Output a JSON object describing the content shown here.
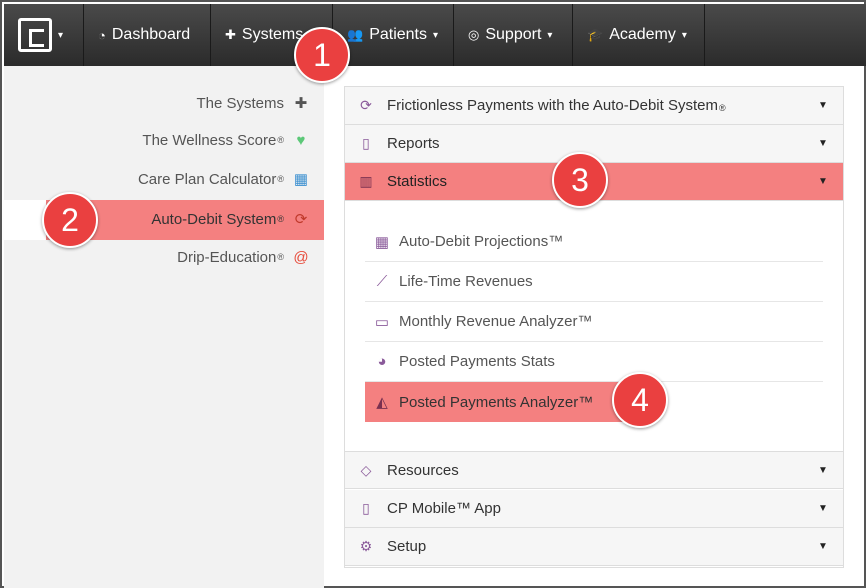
{
  "nav": {
    "brand_logo": "app-logo",
    "items": [
      {
        "label": "Dashboard",
        "icon": "dashboard-icon",
        "glyph": "◔"
      },
      {
        "label": "Systems",
        "icon": "puzzle-icon",
        "glyph": "✚"
      },
      {
        "label": "Patients",
        "icon": "users-icon",
        "glyph": "👥"
      },
      {
        "label": "Support",
        "icon": "lifebuoy-icon",
        "glyph": "◎"
      },
      {
        "label": "Academy",
        "icon": "graduation-cap-icon",
        "glyph": "🎓"
      }
    ],
    "caret": "▾"
  },
  "sidebar": {
    "items": [
      {
        "label": "The Systems",
        "sup": "",
        "icon": "puzzle-icon",
        "glyph": "✚",
        "color": "#555555"
      },
      {
        "label": "The Wellness Score",
        "sup": "®",
        "icon": "heartbeat-icon",
        "glyph": "♥",
        "color": "#5cc878"
      },
      {
        "label": "Care Plan Calculator",
        "sup": "®",
        "icon": "calculator-icon",
        "glyph": "▦",
        "color": "#3a8fd0"
      },
      {
        "label": "Auto-Debit System",
        "sup": "®",
        "icon": "refresh-icon",
        "glyph": "⟳",
        "color": "#c0392b"
      },
      {
        "label": "Drip-Education",
        "sup": "®",
        "icon": "at-icon",
        "glyph": "@",
        "color": "#e74c3c"
      }
    ]
  },
  "panel": {
    "sections": [
      {
        "label": "Frictionless Payments with the Auto-Debit System",
        "sup": "®",
        "icon": "refresh-icon",
        "glyph": "⟳"
      },
      {
        "label": "Reports",
        "sup": "",
        "icon": "file-icon",
        "glyph": "▯"
      },
      {
        "label": "Statistics",
        "sup": "",
        "icon": "bar-chart-icon",
        "glyph": "▥"
      }
    ],
    "statistics_items": [
      {
        "label": "Auto-Debit Projections™",
        "icon": "calendar-grid-icon",
        "glyph": "▦"
      },
      {
        "label": "Life-Time Revenues",
        "icon": "line-chart-icon",
        "glyph": "⟋"
      },
      {
        "label": "Monthly Revenue Analyzer™",
        "icon": "calendar-icon",
        "glyph": "▭"
      },
      {
        "label": "Posted Payments Stats",
        "icon": "pie-chart-icon",
        "glyph": "◕"
      },
      {
        "label": "Posted Payments Analyzer™",
        "icon": "area-chart-icon",
        "glyph": "◭"
      }
    ],
    "bottom_sections": [
      {
        "label": "Resources",
        "icon": "diamond-icon",
        "glyph": "◇"
      },
      {
        "label": "CP Mobile™ App",
        "icon": "mobile-icon",
        "glyph": "▯"
      },
      {
        "label": "Setup",
        "icon": "gears-icon",
        "glyph": "⚙"
      }
    ],
    "caret": "▼"
  },
  "badges": [
    "1",
    "2",
    "3",
    "4"
  ],
  "colors": {
    "highlight": "#f48080",
    "badge": "#ea4040",
    "icon_purple": "#8a5a9a",
    "nav_bg": "#333333"
  }
}
